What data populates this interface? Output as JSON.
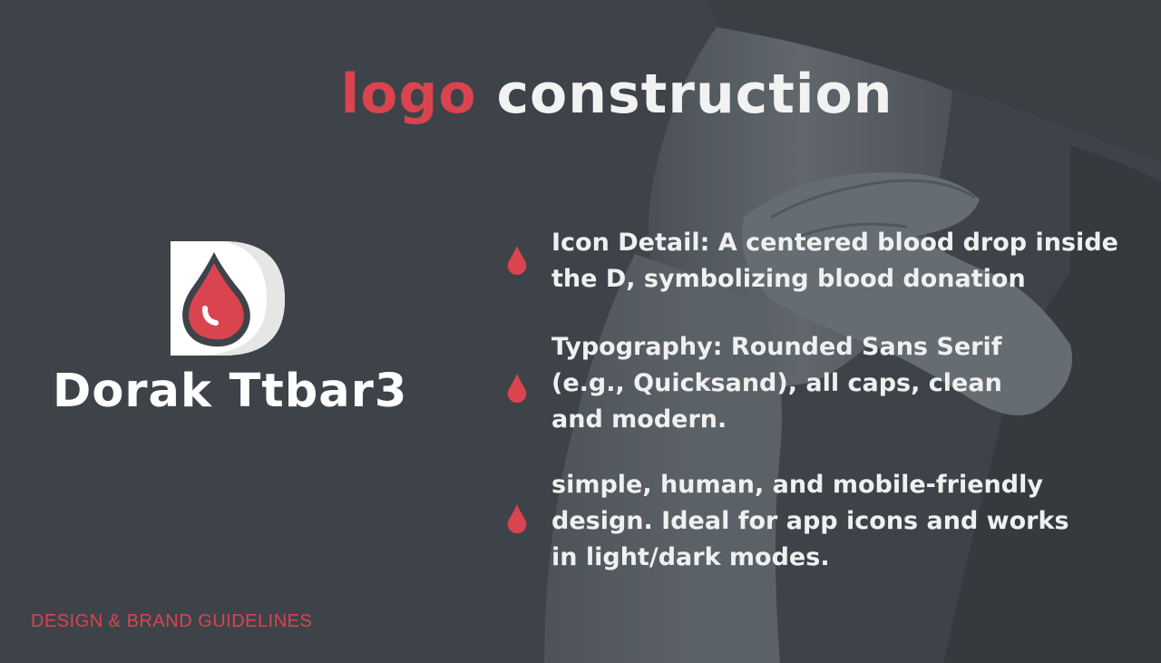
{
  "title": {
    "accent": "logo",
    "main": "construction"
  },
  "brand": {
    "name": "Dorak Ttbar3",
    "icon": "blood-drop-in-d-icon"
  },
  "bullets": [
    {
      "icon": "blood-drop-icon",
      "text": "Icon Detail: A centered blood drop inside\nthe D, symbolizing blood donation"
    },
    {
      "icon": "blood-drop-icon",
      "text": "Typography: Rounded Sans Serif\n(e.g., Quicksand), all caps, clean\nand modern."
    },
    {
      "icon": "blood-drop-icon",
      "text": "simple, human, and mobile-friendly\ndesign. Ideal for app icons and works\nin light/dark modes."
    }
  ],
  "footer": "DESIGN & BRAND GUIDELINES",
  "colors": {
    "background": "#3d4349",
    "accent": "#d9444f",
    "text": "#f2f2f2"
  }
}
